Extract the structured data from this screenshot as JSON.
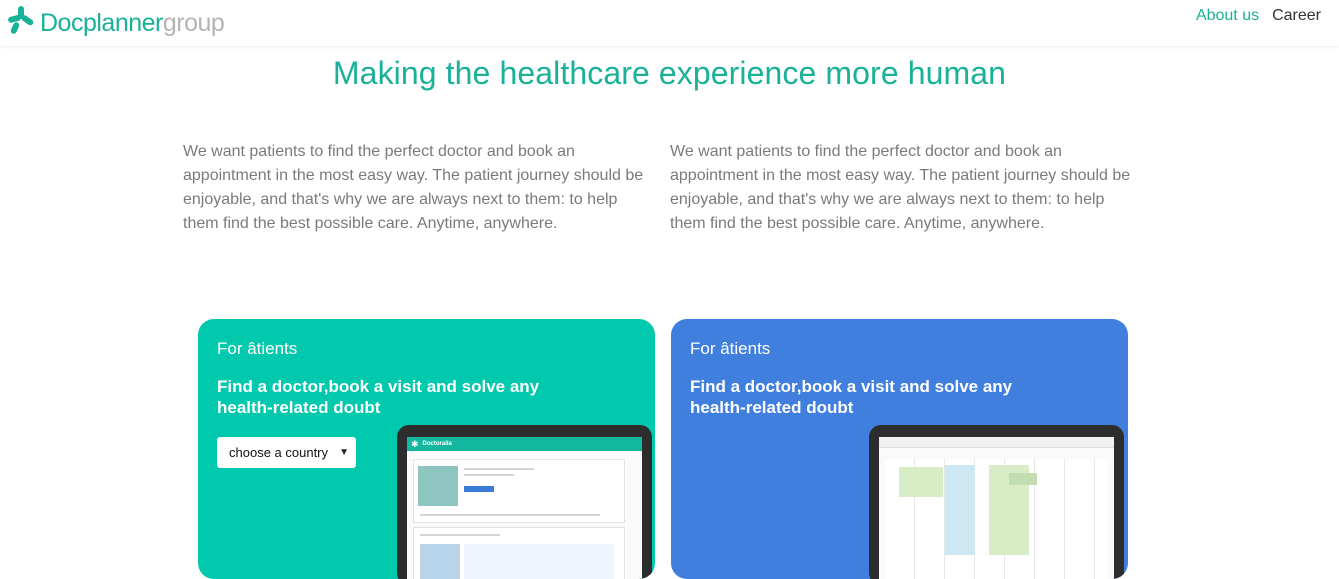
{
  "header": {
    "logo_main": "Docplanner",
    "logo_sub": "group",
    "nav": {
      "about": "About us",
      "career": "Career"
    }
  },
  "hero": {
    "title": "Making the healthcare experience more human"
  },
  "intro": {
    "left": "We want patients to find the perfect doctor and book an appointment in the most easy way. The patient journey should be enjoyable, and that's why we are always next to them: to help them find the best possible care. Anytime, anywhere.",
    "right": "We want patients to find the perfect doctor and book an appointment in the most easy way. The patient journey should be enjoyable, and that's why we are always next to them: to help them find the best possible care. Anytime, anywhere."
  },
  "cards": [
    {
      "label": "For âtients",
      "title": "Find a doctor,book a visit and solve any health-related doubt",
      "select": {
        "value": "choose a country"
      },
      "device": {
        "brand": "Doctoralia"
      }
    },
    {
      "label": "For âtients",
      "title": "Find a doctor,book a visit and solve any health-related doubt"
    }
  ],
  "colors": {
    "brand": "#1ab199",
    "card_green": "#00c9ad",
    "card_blue": "#417fdf",
    "muted_text": "#7a7a7a"
  },
  "icons": {
    "logo": "docplanner-logo-icon",
    "select": "caret-down-icon",
    "device_brand": "star-icon"
  }
}
